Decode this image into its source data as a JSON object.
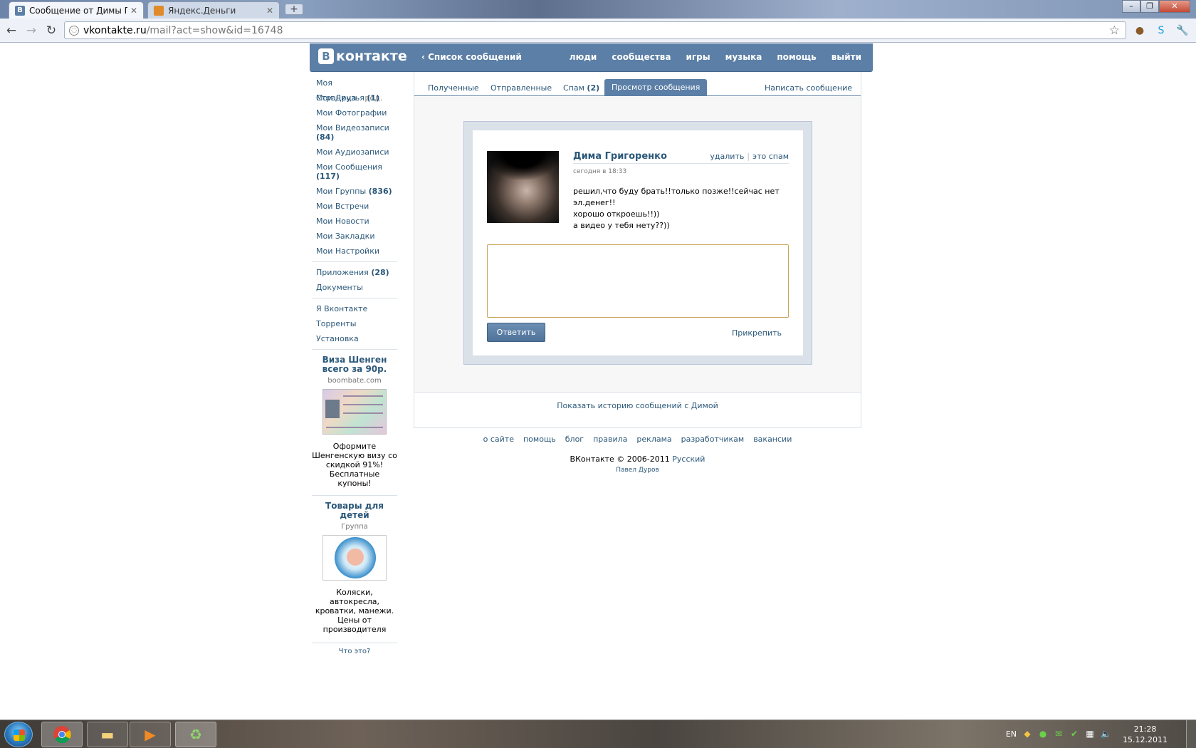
{
  "browser": {
    "tabs": [
      {
        "title": "Сообщение от Димы Григ",
        "favicon": "В"
      },
      {
        "title": "Яндекс.Деньги",
        "favicon": ""
      }
    ],
    "new_tab": "+",
    "address": {
      "host": "vkontakte.ru",
      "path": "/mail?act=show&id=16748"
    },
    "window_controls": [
      "minimize-icon",
      "maximize-icon",
      "close-icon"
    ]
  },
  "header": {
    "logo_letter": "В",
    "logo_text": "контакте",
    "back_link": "Список сообщений",
    "nav": [
      "люди",
      "сообщества",
      "игры",
      "музыка",
      "помощь",
      "выйти"
    ],
    "color": "#5b7fa6"
  },
  "sidebar": {
    "my_page": "Моя Страница",
    "edit": "ред.",
    "items": [
      {
        "label": "Мои Друзья",
        "count": "(1)"
      },
      {
        "label": "Мои Фотографии",
        "count": ""
      },
      {
        "label": "Мои Видеозаписи",
        "count": "(84)"
      },
      {
        "label": "Мои Аудиозаписи",
        "count": ""
      },
      {
        "label": "Мои Сообщения",
        "count": "(117)"
      },
      {
        "label": "Мои Группы",
        "count": "(836)"
      },
      {
        "label": "Мои Встречи",
        "count": ""
      },
      {
        "label": "Мои Новости",
        "count": ""
      },
      {
        "label": "Мои Закладки",
        "count": ""
      },
      {
        "label": "Мои Настройки",
        "count": ""
      }
    ],
    "apps": [
      {
        "label": "Приложения",
        "count": "(28)"
      },
      {
        "label": "Документы",
        "count": ""
      }
    ],
    "extra": [
      "Я Вконтакте",
      "Торренты",
      "Установка"
    ],
    "ads": [
      {
        "title": "Виза Шенген всего за 90р.",
        "source": "boombate.com",
        "text": "Оформите Шенгенскую визу со скидкой 91%! Бесплатные купоны!"
      },
      {
        "title": "Товары для детей",
        "source": "Группа",
        "text": "Коляски, автокресла, кроватки, манежи. Цены от производителя"
      }
    ],
    "what_is": "Что это?"
  },
  "mail": {
    "tabs": [
      {
        "label": "Полученные",
        "count": ""
      },
      {
        "label": "Отправленные",
        "count": ""
      },
      {
        "label": "Спам",
        "count": "(2)"
      },
      {
        "label": "Просмотр сообщения",
        "count": ""
      }
    ],
    "write": "Написать сообщение",
    "message": {
      "sender": "Дима Григоренко",
      "delete": "удалить",
      "separator": "|",
      "spam": "это спам",
      "time": "сегодня в 18:33",
      "lines": [
        "решил,что буду брать!!только позже!!сейчас нет эл.денег!!",
        "хорошо откроешь!!))",
        "а видео у тебя нету??))"
      ]
    },
    "reply_value": "",
    "reply_button": "Ответить",
    "attach": "Прикрепить",
    "history": "Показать историю сообщений с Димой"
  },
  "footer": {
    "links": [
      "о сайте",
      "помощь",
      "блог",
      "правила",
      "реклама",
      "разработчикам",
      "вакансии"
    ],
    "copyright": "ВКонтакте © 2006-2011",
    "language": "Русский",
    "author": "Павел Дуров"
  },
  "taskbar": {
    "apps": [
      "chrome-icon",
      "explorer-icon",
      "media-player-icon",
      "recycle-icon"
    ],
    "lang": "EN",
    "time": "21:28",
    "date": "15.12.2011"
  }
}
